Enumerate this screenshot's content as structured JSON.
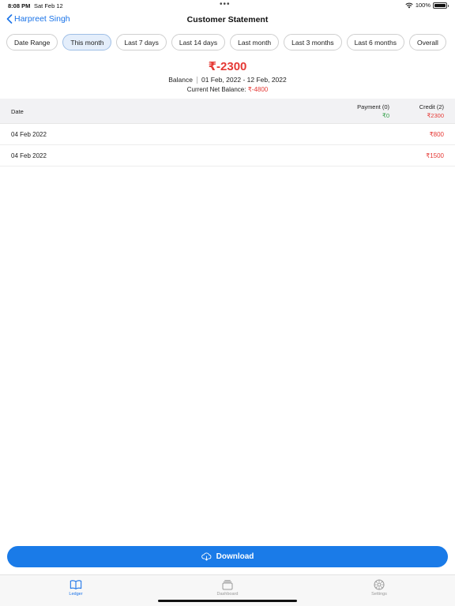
{
  "status_bar": {
    "time": "8:08 PM",
    "date": "Sat Feb 12",
    "battery": "100%"
  },
  "nav": {
    "back_label": "Harpreet Singh",
    "title": "Customer Statement"
  },
  "filters": [
    {
      "label": "Date Range",
      "active": false
    },
    {
      "label": "This month",
      "active": true
    },
    {
      "label": "Last 7 days",
      "active": false
    },
    {
      "label": "Last 14 days",
      "active": false
    },
    {
      "label": "Last month",
      "active": false
    },
    {
      "label": "Last 3 months",
      "active": false
    },
    {
      "label": "Last 6 months",
      "active": false
    },
    {
      "label": "Overall",
      "active": false
    }
  ],
  "balance": {
    "amount": "₹-2300",
    "label": "Balance",
    "range": "01 Feb, 2022 - 12 Feb, 2022",
    "net_label": "Current Net Balance:",
    "net_value": "₹-4800"
  },
  "table": {
    "date_header": "Date",
    "payment_header": "Payment (0)",
    "payment_total": "₹0",
    "credit_header": "Credit (2)",
    "credit_total": "₹2300",
    "rows": [
      {
        "date": "04 Feb 2022",
        "credit": "₹800"
      },
      {
        "date": "04 Feb 2022",
        "credit": "₹1500"
      }
    ]
  },
  "download_label": "Download",
  "tabs": [
    {
      "label": "Ledger",
      "icon": "book-icon",
      "active": true
    },
    {
      "label": "Dashboard",
      "icon": "cards-icon",
      "active": false
    },
    {
      "label": "Settings",
      "icon": "gear-icon",
      "active": false
    }
  ],
  "colors": {
    "accent": "#1a7be8",
    "negative": "#e53935",
    "positive": "#2e9e44"
  }
}
